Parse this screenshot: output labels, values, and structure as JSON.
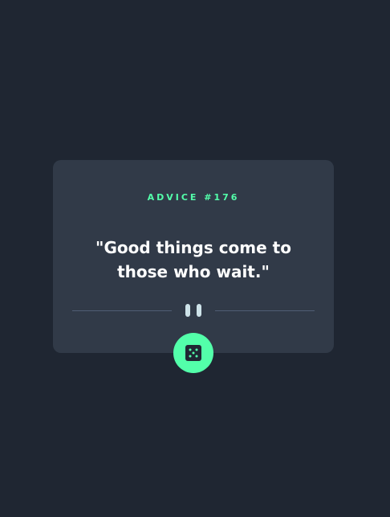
{
  "card": {
    "advice_label": "ADVICE #176",
    "advice_text": "\"Good things come to those who wait.\""
  },
  "icons": {
    "divider": "pause-icon",
    "dice": "dice-icon"
  },
  "colors": {
    "background": "#1f2632",
    "card": "#313a48",
    "accent": "#53ffaa",
    "divider": "#4f5d74",
    "text": "#ffffff"
  }
}
